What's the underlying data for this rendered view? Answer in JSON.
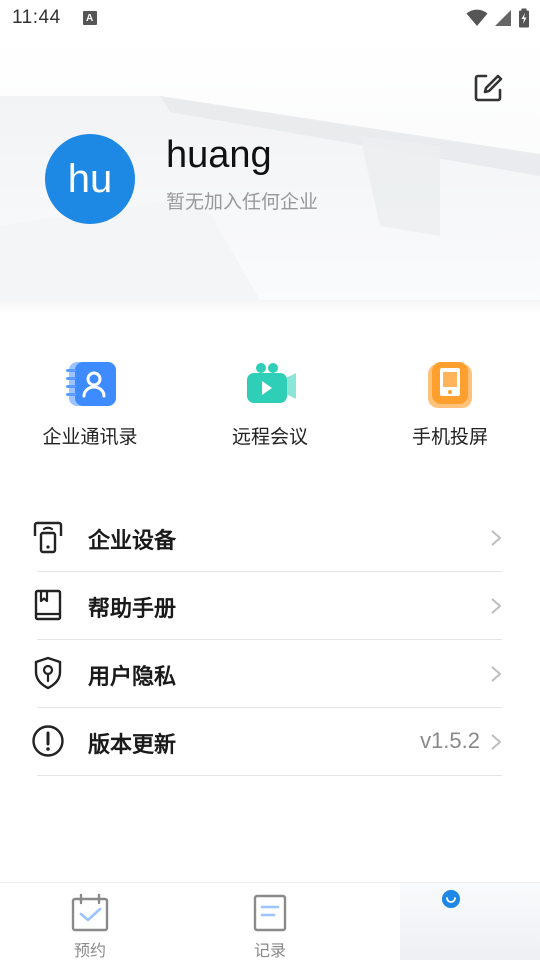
{
  "status_bar": {
    "time": "11:44",
    "notification_icon": "A"
  },
  "profile": {
    "avatar_text": "hu",
    "name": "huang",
    "subtitle": "暂无加入任何企业",
    "edit_icon": "edit-icon",
    "avatar_color": "#1e88e5"
  },
  "quick_actions": [
    {
      "label": "企业通讯录",
      "icon": "contacts-book-icon",
      "color": "#3d8bff"
    },
    {
      "label": "远程会议",
      "icon": "video-camera-icon",
      "color": "#2ecfb6"
    },
    {
      "label": "手机投屏",
      "icon": "phone-cast-icon",
      "color": "#ff9f2e"
    }
  ],
  "menu": [
    {
      "label": "企业设备",
      "icon": "device-icon",
      "value": ""
    },
    {
      "label": "帮助手册",
      "icon": "book-icon",
      "value": ""
    },
    {
      "label": "用户隐私",
      "icon": "shield-icon",
      "value": ""
    },
    {
      "label": "版本更新",
      "icon": "info-icon",
      "value": "v1.5.2"
    }
  ],
  "tabbar": {
    "tabs": [
      {
        "label": "预约",
        "icon": "calendar-check-icon"
      },
      {
        "label": "记录",
        "icon": "document-icon"
      },
      {
        "label": "",
        "icon": "profile-icon",
        "active": true
      }
    ],
    "active_color": "#1e88e5",
    "inactive_color": "#8a8a8a"
  }
}
